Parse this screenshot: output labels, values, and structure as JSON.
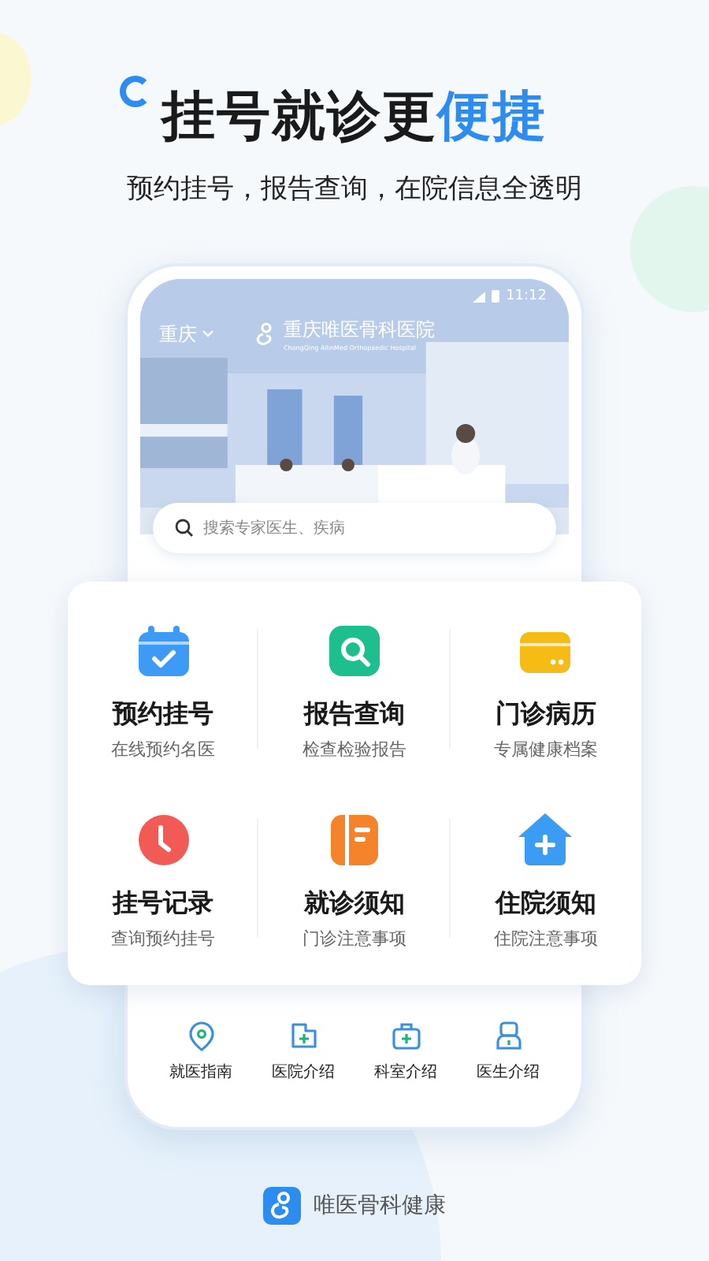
{
  "headline": {
    "text": "挂号就诊更",
    "highlight": "便捷"
  },
  "subtitle": "预约挂号，报告查询，在院信息全透明",
  "phone": {
    "status_bar": {
      "time": "11:12"
    },
    "city": "重庆",
    "hospital_name": "重庆唯医骨科医院",
    "hospital_name_en": "ChongQing AllinMed Orthopaedic Hospital",
    "search": {
      "placeholder": "搜索专家医生、疾病"
    }
  },
  "services": [
    {
      "kind": "calendar",
      "color": "#3e9bf5",
      "title": "预约挂号",
      "subtitle": "在线预约名医"
    },
    {
      "kind": "search",
      "color": "#1dbf8e",
      "title": "报告查询",
      "subtitle": "检查检验报告"
    },
    {
      "kind": "card",
      "color": "#f7bb16",
      "title": "门诊病历",
      "subtitle": "专属健康档案"
    },
    {
      "kind": "clock",
      "color": "#f25b55",
      "title": "挂号记录",
      "subtitle": "查询预约挂号"
    },
    {
      "kind": "book",
      "color": "#f5832a",
      "title": "就诊须知",
      "subtitle": "门诊注意事项"
    },
    {
      "kind": "house",
      "color": "#3a9cf3",
      "title": "住院须知",
      "subtitle": "住院注意事项"
    }
  ],
  "links": [
    {
      "kind": "pin",
      "label": "就医指南"
    },
    {
      "kind": "hospital",
      "label": "医院介绍"
    },
    {
      "kind": "kit",
      "label": "科室介绍"
    },
    {
      "kind": "doctor",
      "label": "医生介绍"
    }
  ],
  "footer": {
    "app_name": "唯医骨科健康"
  }
}
